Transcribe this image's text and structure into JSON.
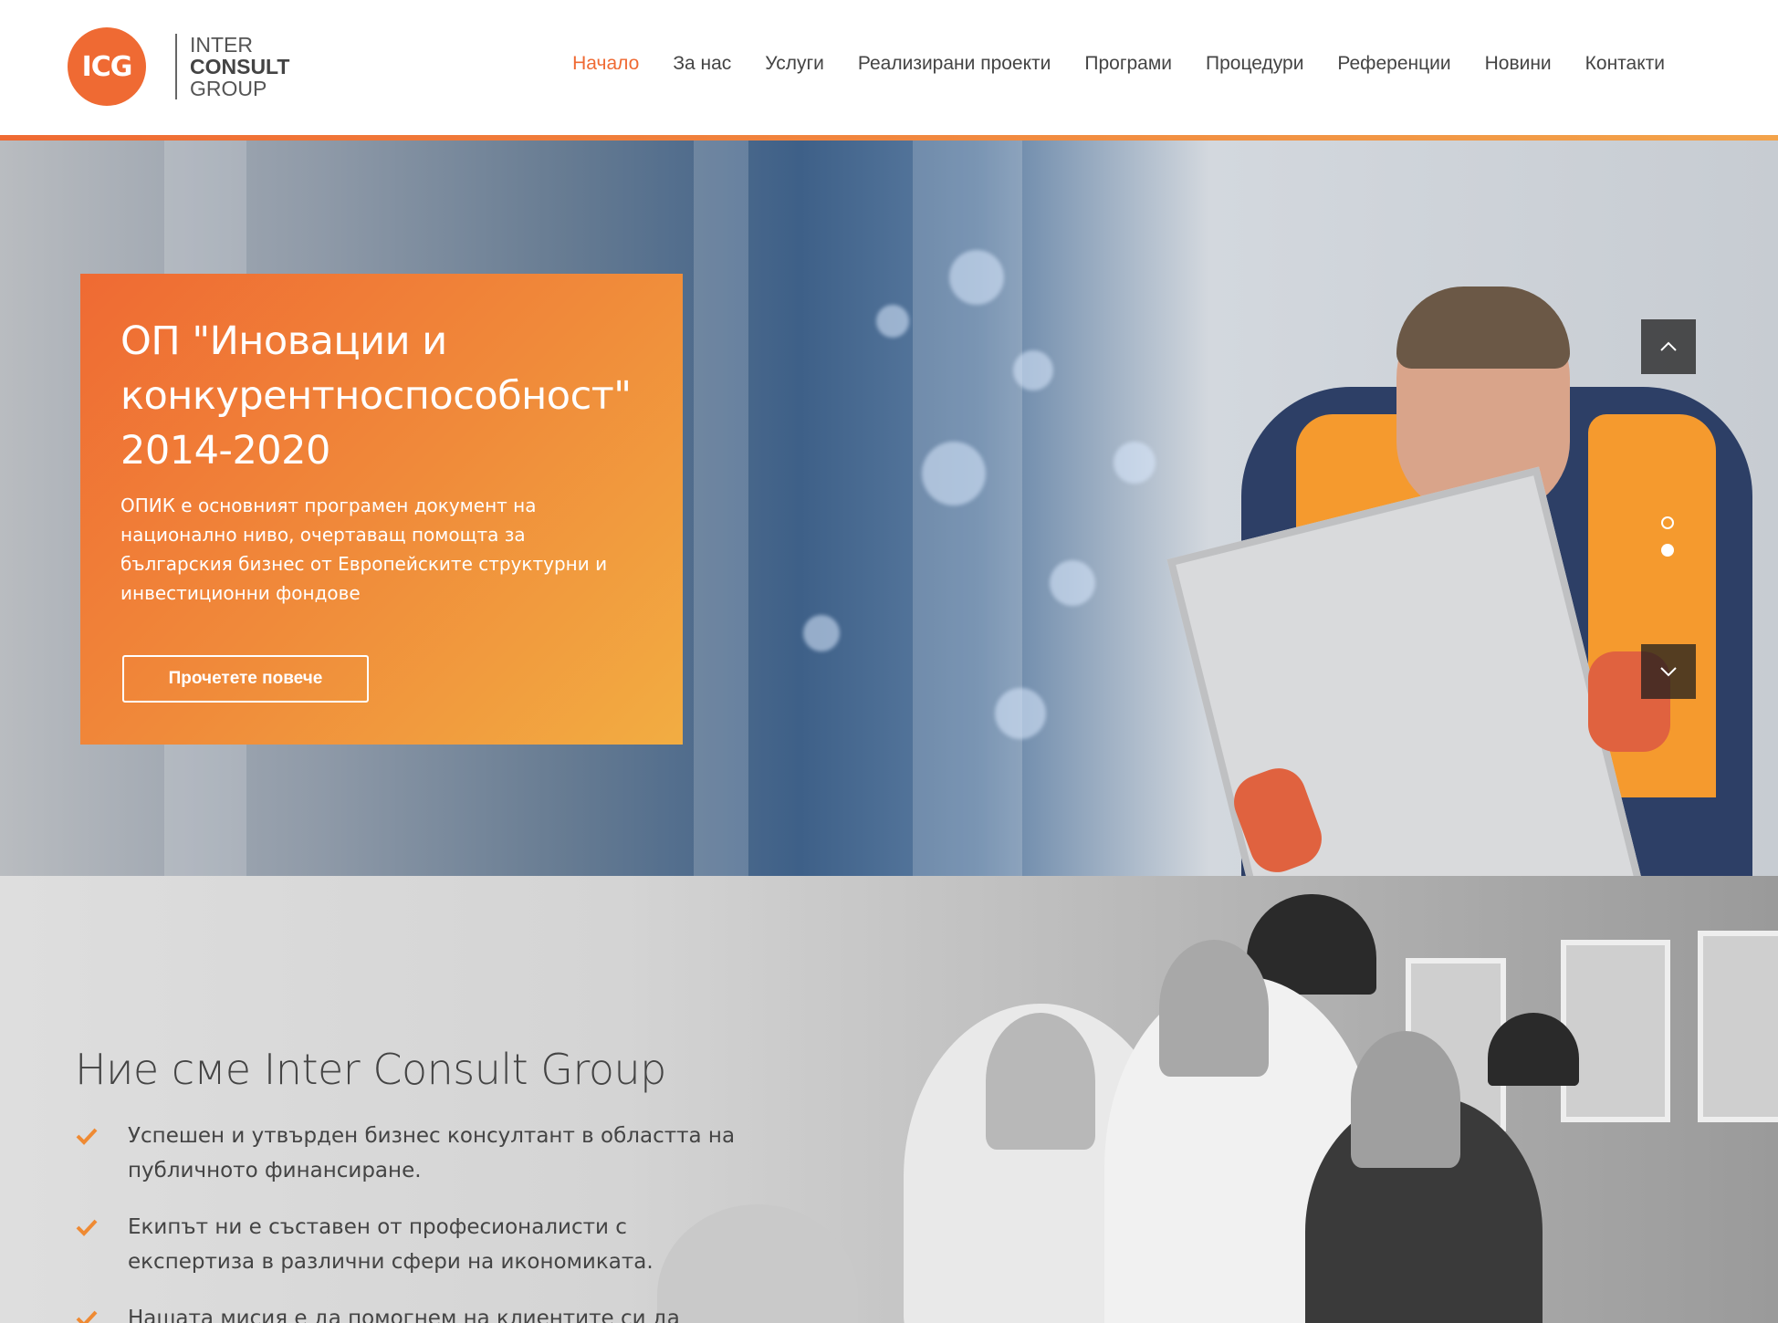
{
  "logo": {
    "mark": "ICG",
    "line1": "INTER",
    "line2": "CONSULT",
    "line3": "GROUP"
  },
  "nav": {
    "items": [
      {
        "label": "Начало",
        "active": true
      },
      {
        "label": "За нас",
        "active": false
      },
      {
        "label": "Услуги",
        "active": false
      },
      {
        "label": "Реализирани проекти",
        "active": false
      },
      {
        "label": "Програми",
        "active": false
      },
      {
        "label": "Процедури",
        "active": false
      },
      {
        "label": "Референции",
        "active": false
      },
      {
        "label": "Новини",
        "active": false
      },
      {
        "label": "Контакти",
        "active": false
      }
    ]
  },
  "hero": {
    "title": "ОП \"Иновации и конкурентноспособност\" 2014-2020",
    "text": "ОПИК е основният програмен документ на национално ниво, очертаващ помощта за българския бизнес от Европейските структурни и инвестиционни фондове",
    "button_label": "Прочетете повече",
    "slide_count": 2,
    "active_slide": 2
  },
  "about": {
    "title": "Ние сме Inter Consult Group",
    "items": [
      "Успешен и утвърден бизнес консултант в областта на публичното финансиране.",
      "Екипът ни е съставен от професионалисти с експертиза в различни сфери на икономиката.",
      "Нашата мисия е да помогнем на клиентите си да"
    ]
  },
  "colors": {
    "accent": "#ef6a33",
    "accent_light": "#f2ad42",
    "text": "#444444"
  },
  "icons": [
    "chevron-up-icon",
    "chevron-down-icon",
    "check-icon"
  ]
}
